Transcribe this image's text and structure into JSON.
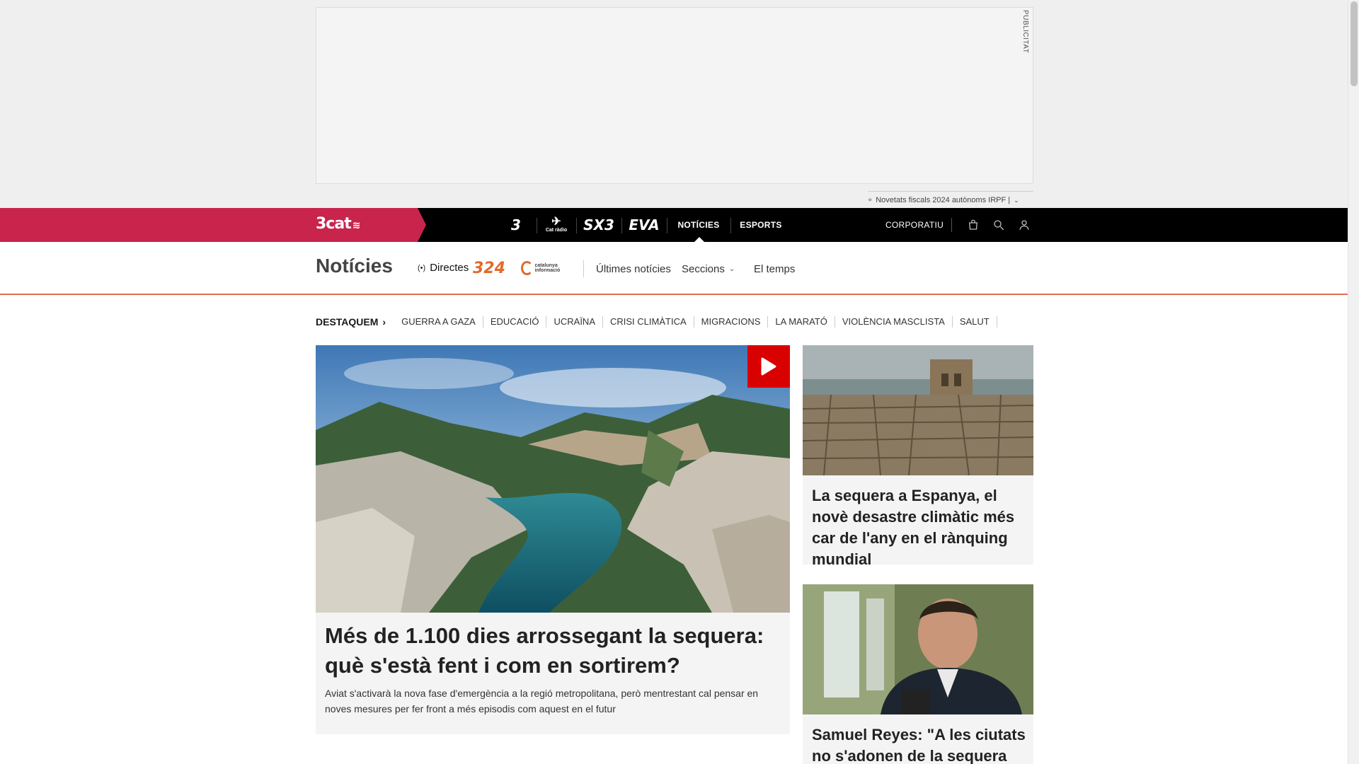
{
  "ad": {
    "label": "PUBLICITAT",
    "note": "Novetats fiscals 2024 autònoms IRPF |"
  },
  "topnav": {
    "brand": "3cat",
    "channels": {
      "tv3": "3",
      "catradio": "Cat ràdio",
      "sx3": "SX3",
      "eva": "EVA"
    },
    "tabs": {
      "noticies": "NOTÍCIES",
      "esports": "ESPORTS",
      "corporatiu": "CORPORATIU"
    },
    "icons": [
      "shopping-bag-icon",
      "search-icon",
      "user-icon"
    ]
  },
  "section": {
    "title": "Notícies",
    "live": "Directes",
    "logo_324": "324",
    "logo_ci": "catalunya informació",
    "links": {
      "ultimes": "Últimes notícies",
      "seccions": "Seccions",
      "temps": "El temps"
    }
  },
  "featured": {
    "heading": "DESTAQUEM",
    "tags": [
      "GUERRA A GAZA",
      "EDUCACIÓ",
      "UCRAÏNA",
      "CRISI CLIMÀTICA",
      "MIGRACIONS",
      "LA MARATÓ",
      "VIOLÈNCIA MASCLISTA",
      "SALUT"
    ]
  },
  "main_article": {
    "title": "Més de 1.100 dies arrossegant la sequera: què s'està fent i com en sortirem?",
    "summary": "Aviat s'activarà la nova fase d'emergència a la regió metropolitana, però mentrestant cal pensar en noves mesures per fer front a més episodis com aquest en el futur",
    "has_video": true
  },
  "side_articles": [
    {
      "title": "La sequera a Espanya, el novè desastre climàtic més car de l'any en el rànquing mundial"
    },
    {
      "title": "Samuel Reyes: \"A les ciutats no s'adonen de la sequera fins"
    }
  ],
  "colors": {
    "brand": "#c8244c",
    "accent_324": "#e26a2b",
    "play": "#d90000",
    "nav_bg": "#000000"
  }
}
